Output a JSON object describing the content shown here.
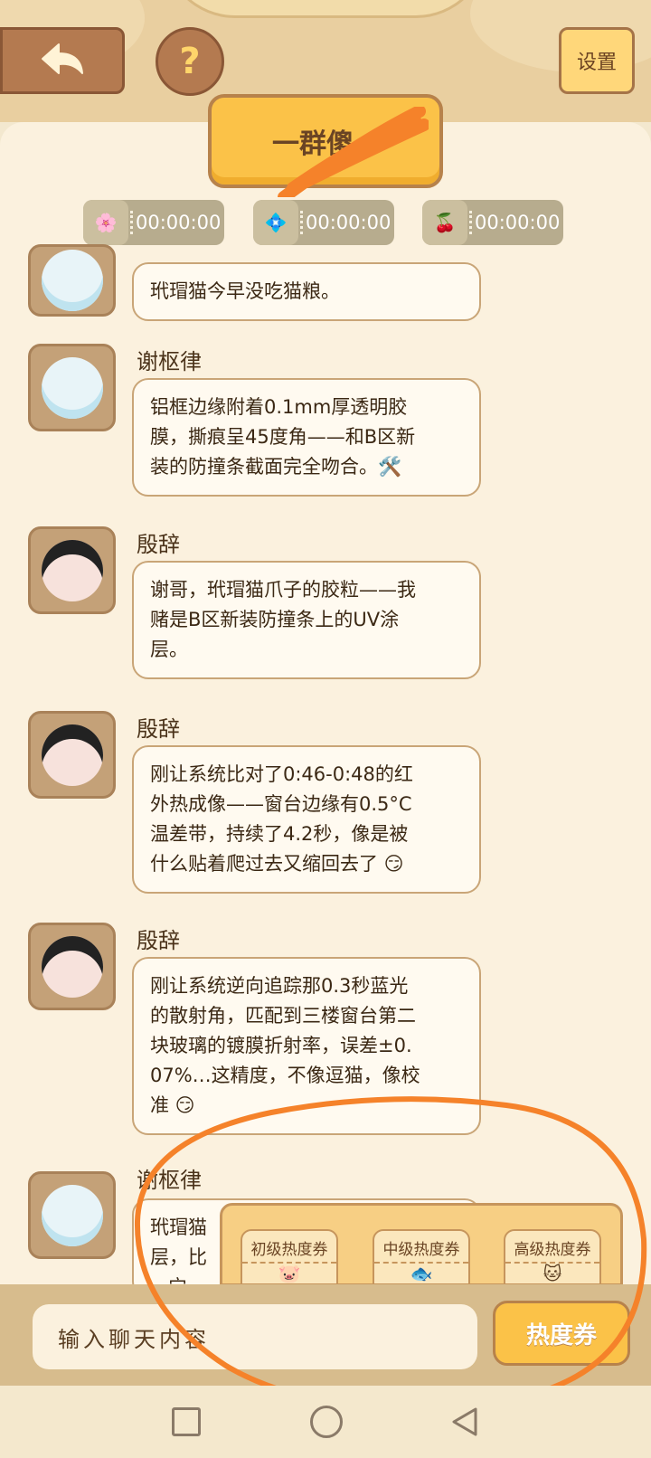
{
  "header": {
    "settings_label": "设置",
    "help_label": "?",
    "group_title": "一群傻"
  },
  "timers": [
    {
      "time": "00:00:00",
      "icon": "pink-chibi"
    },
    {
      "time": "00:00:00",
      "icon": "blue-chibi"
    },
    {
      "time": "00:00:00",
      "icon": "red-chibi"
    }
  ],
  "messages": [
    {
      "sender": "",
      "text": "玳瑁猫今早没吃猫粮。",
      "avatar": "light-blue-hair-avatar"
    },
    {
      "sender": "谢枢律",
      "text": "铝框边缘附着0.1mm厚透明胶\n膜，撕痕呈45度角——和B区新\n装的防撞条截面完全吻合。🛠️",
      "avatar": "light-blue-hair-avatar"
    },
    {
      "sender": "殷辞",
      "text": "谢哥，玳瑁猫爪子的胶粒——我\n赌是B区新装防撞条上的UV涂\n层。",
      "avatar": "black-hair-horns-avatar"
    },
    {
      "sender": "殷辞",
      "text": "刚让系统比对了0:46-0:48的红\n外热成像——窗台边缘有0.5°C\n温差带，持续了4.2秒，像是被\n什么贴着爬过去又缩回去了 😏",
      "avatar": "black-hair-horns-avatar"
    },
    {
      "sender": "殷辞",
      "text": "刚让系统逆向追踪那0.3秒蓝光\n的散射角，匹配到三楼窗台第二\n块玻璃的镀膜折射率，误差±0.\n07%…这精度，不像逗猫，像校\n准 😏",
      "avatar": "black-hair-horns-avatar"
    },
    {
      "sender": "谢枢律",
      "text": "玳瑁猫\n层，比\n   宁",
      "avatar": "light-blue-hair-avatar"
    }
  ],
  "tickets": [
    {
      "label": "初级热度券"
    },
    {
      "label": "中级热度券"
    },
    {
      "label": "高级热度券"
    }
  ],
  "input": {
    "placeholder": "输入聊天内容",
    "heat_button": "热度券"
  },
  "colors": {
    "accent": "#fbc248",
    "bubble_border": "#c9a577",
    "annotation": "#f5822a"
  }
}
